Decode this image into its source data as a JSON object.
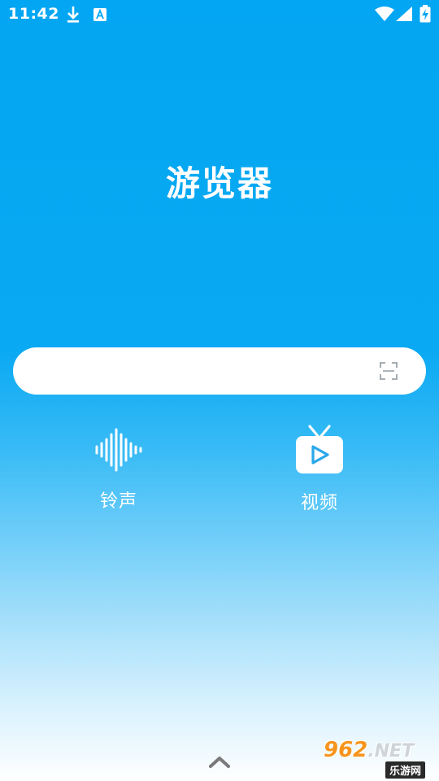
{
  "status_bar": {
    "time": "11:42",
    "icons": [
      "download-icon",
      "text-app-icon",
      "wifi-icon",
      "signal-icon",
      "battery-charging-icon"
    ]
  },
  "app": {
    "title": "游览器"
  },
  "search": {
    "value": "",
    "placeholder": "",
    "scan_icon": "scan-icon"
  },
  "features": [
    {
      "label": "铃声",
      "icon": "sound-wave-icon"
    },
    {
      "label": "视频",
      "icon": "tv-play-icon"
    }
  ],
  "bottom": {
    "expand_icon": "chevron-up-icon"
  },
  "watermark": {
    "brand": "962",
    "suffix": ".NET",
    "site_name": "乐游网"
  },
  "colors": {
    "primary": "#03a6f2",
    "white": "#ffffff",
    "icon_accent": "#2aa7ea"
  }
}
